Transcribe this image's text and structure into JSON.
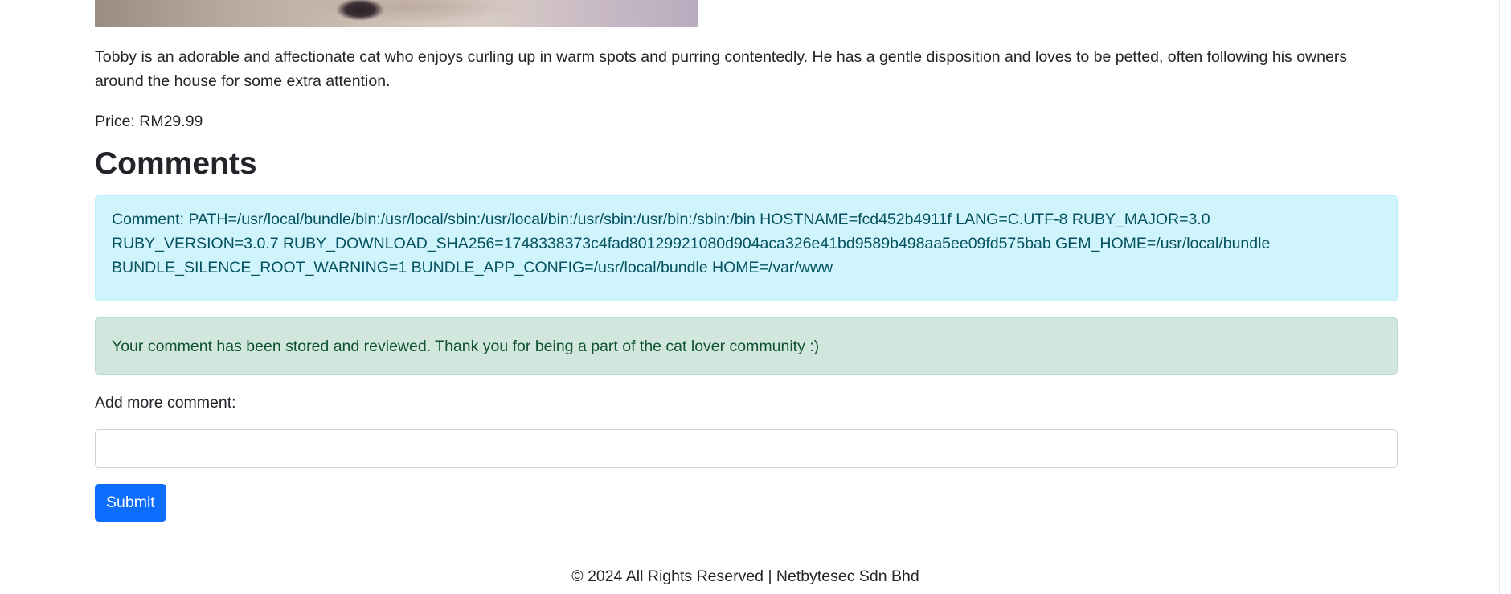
{
  "product": {
    "image_alt": "Tobby the cat",
    "description": "Tobby is an adorable and affectionate cat who enjoys curling up in warm spots and purring contentedly. He has a gentle disposition and loves to be petted, often following his owners around the house for some extra attention.",
    "price": "Price: RM29.99"
  },
  "comments": {
    "heading": "Comments",
    "entries": [
      {
        "text": "Comment: PATH=/usr/local/bundle/bin:/usr/local/sbin:/usr/local/bin:/usr/sbin:/usr/bin:/sbin:/bin HOSTNAME=fcd452b4911f LANG=C.UTF-8 RUBY_MAJOR=3.0 RUBY_VERSION=3.0.7 RUBY_DOWNLOAD_SHA256=1748338373c4fad80129921080d904aca326e41bd9589b498aa5ee09fd575bab GEM_HOME=/usr/local/bundle BUNDLE_SILENCE_ROOT_WARNING=1 BUNDLE_APP_CONFIG=/usr/local/bundle HOME=/var/www"
      }
    ],
    "success_message": "Your comment has been stored and reviewed. Thank you for being a part of the cat lover community :)"
  },
  "form": {
    "label": "Add more comment:",
    "input_value": "",
    "submit_label": "Submit"
  },
  "footer": {
    "text": "© 2024 All Rights Reserved | Netbytesec Sdn Bhd"
  },
  "colors": {
    "primary": "#0d6efd",
    "info_bg": "#cff4fc",
    "info_text": "#055160",
    "success_bg": "#d1e7dd",
    "success_text": "#0f5132"
  }
}
